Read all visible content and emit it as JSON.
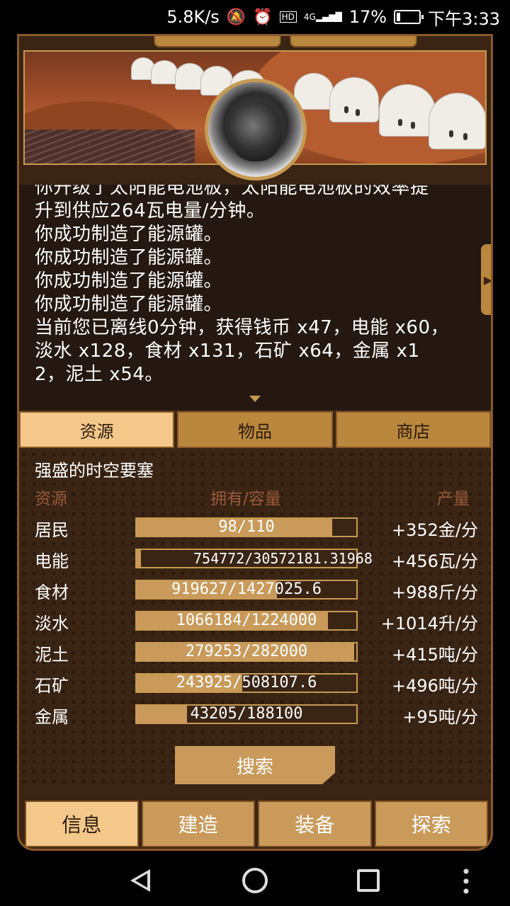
{
  "statusbar": {
    "net_speed": "5.8K/s",
    "signal_label": "4G",
    "hd_label": "HD",
    "battery": "17%",
    "time": "下午3:33"
  },
  "log": {
    "lines": [
      "你升级了太阳能电池板，太阳能电池板的效率提",
      "升到供应264瓦电量/分钟。",
      "你成功制造了能源罐。",
      "你成功制造了能源罐。",
      "你成功制造了能源罐。",
      "你成功制造了能源罐。",
      "当前您已离线0分钟，获得钱币 x47，电能 x60，",
      "淡水 x128，食材 x131，石矿 x64，金属 x1",
      "2，泥土 x54。"
    ]
  },
  "section_tabs": [
    {
      "label": "资源",
      "active": true
    },
    {
      "label": "物品",
      "active": false
    },
    {
      "label": "商店",
      "active": false
    }
  ],
  "panel": {
    "fortress_name": "强盛的时空要塞",
    "header_resource": "资源",
    "header_owned": "拥有/容量",
    "header_rate": "产量",
    "resources": [
      {
        "name": "居民",
        "value": "98/110",
        "fill": 0.89,
        "rate": "+352金/分"
      },
      {
        "name": "电能",
        "value": "754772/30572181.31968",
        "fill": 0.02,
        "rate": "+456瓦/分"
      },
      {
        "name": "食材",
        "value": "919627/1427025.6",
        "fill": 0.64,
        "rate": "+988斤/分"
      },
      {
        "name": "淡水",
        "value": "1066184/1224000",
        "fill": 0.87,
        "rate": "+1014升/分"
      },
      {
        "name": "泥土",
        "value": "279253/282000",
        "fill": 0.99,
        "rate": "+415吨/分"
      },
      {
        "name": "石矿",
        "value": "243925/508107.6",
        "fill": 0.48,
        "rate": "+496吨/分"
      },
      {
        "name": "金属",
        "value": "43205/188100",
        "fill": 0.23,
        "rate": "+95吨/分"
      }
    ]
  },
  "search_label": "搜索",
  "nav_tabs": [
    {
      "label": "信息",
      "active": true
    },
    {
      "label": "建造",
      "active": false
    },
    {
      "label": "装备",
      "active": false
    },
    {
      "label": "探索",
      "active": false
    }
  ],
  "colors": {
    "frame": "#3a2414",
    "gold": "#c99a5a",
    "active_tab": "#f4c88a",
    "header_text": "#9a5a3a"
  }
}
